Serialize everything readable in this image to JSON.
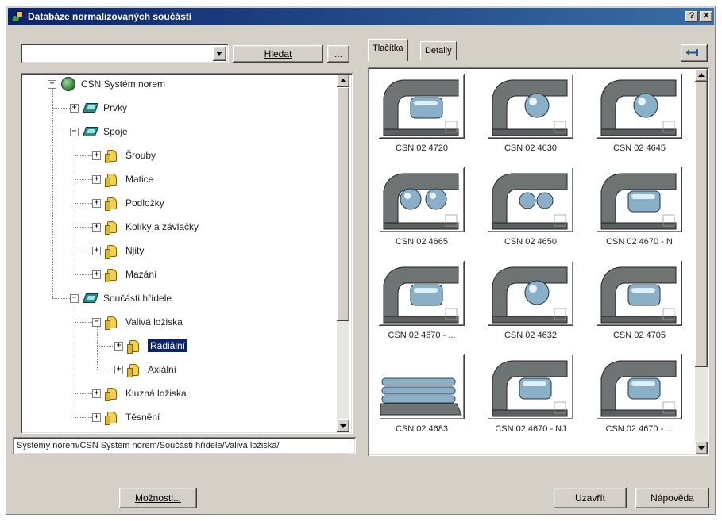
{
  "window": {
    "title": "Databáze normalizovaných součástí",
    "help_btn": "?",
    "close_btn": "✕"
  },
  "search": {
    "value": "",
    "button_label": "Hledat",
    "browse_label": "..."
  },
  "tree": {
    "items": [
      {
        "label": "CSN Systém norem",
        "level": 0,
        "icon": "globe-icon",
        "expanded": true
      },
      {
        "label": "Prvky",
        "level": 1,
        "icon": "book-icon",
        "expanded": false
      },
      {
        "label": "Spoje",
        "level": 1,
        "icon": "book-icon",
        "expanded": true
      },
      {
        "label": "Šrouby",
        "level": 2,
        "icon": "folder-icon",
        "expanded": false
      },
      {
        "label": "Matice",
        "level": 2,
        "icon": "folder-icon",
        "expanded": false
      },
      {
        "label": "Podložky",
        "level": 2,
        "icon": "folder-icon",
        "expanded": false
      },
      {
        "label": "Kolíky a závlačky",
        "level": 2,
        "icon": "folder-icon",
        "expanded": false
      },
      {
        "label": "Njity",
        "level": 2,
        "icon": "folder-icon",
        "expanded": false
      },
      {
        "label": "Mazání",
        "level": 2,
        "icon": "folder-icon",
        "expanded": false
      },
      {
        "label": "Součásti hřídele",
        "level": 1,
        "icon": "book-icon",
        "expanded": true
      },
      {
        "label": "Valivá ložiska",
        "level": 2,
        "icon": "folder-icon",
        "expanded": true
      },
      {
        "label": "Radiální",
        "level": 3,
        "icon": "folder-icon",
        "expanded": false,
        "selected": true
      },
      {
        "label": "Axiální",
        "level": 3,
        "icon": "folder-icon",
        "expanded": false
      },
      {
        "label": "Kluzná ložiska",
        "level": 2,
        "icon": "folder-icon",
        "expanded": false
      },
      {
        "label": "Těsnění",
        "level": 2,
        "icon": "folder-icon",
        "expanded": false
      }
    ]
  },
  "path": "Systémy norem/CSN Systém norem/Součásti hřídele/Valivá ložiska/",
  "tabs": [
    {
      "label": "Tlačítka",
      "active": true
    },
    {
      "label": "Detaily",
      "active": false
    }
  ],
  "gallery": {
    "items": [
      {
        "label": "CSN 02 4720",
        "style": "roller"
      },
      {
        "label": "CSN 02 4630",
        "style": "ball"
      },
      {
        "label": "CSN 02 4645",
        "style": "ball"
      },
      {
        "label": "CSN 02 4665",
        "style": "double-ball"
      },
      {
        "label": "CSN 02 4650",
        "style": "double-ball-small"
      },
      {
        "label": "CSN 02 4670 - N",
        "style": "roller"
      },
      {
        "label": "CSN 02 4670 - ...",
        "style": "roller"
      },
      {
        "label": "CSN 02 4632",
        "style": "ball"
      },
      {
        "label": "CSN 02 4705",
        "style": "roller"
      },
      {
        "label": "CSN 02 4683",
        "style": "needle"
      },
      {
        "label": "CSN 02 4670 - NJ",
        "style": "roller"
      },
      {
        "label": "CSN 02 4670 - ...",
        "style": "roller"
      }
    ]
  },
  "buttons": {
    "options": "Možnosti...",
    "close": "Uzavřít",
    "help": "Nápověda"
  },
  "colors": {
    "face": "#d4d0c8",
    "title": "#0a246a",
    "selection": "#0a246a",
    "steel": "#8ab0c8",
    "housing": "#6e7474"
  }
}
